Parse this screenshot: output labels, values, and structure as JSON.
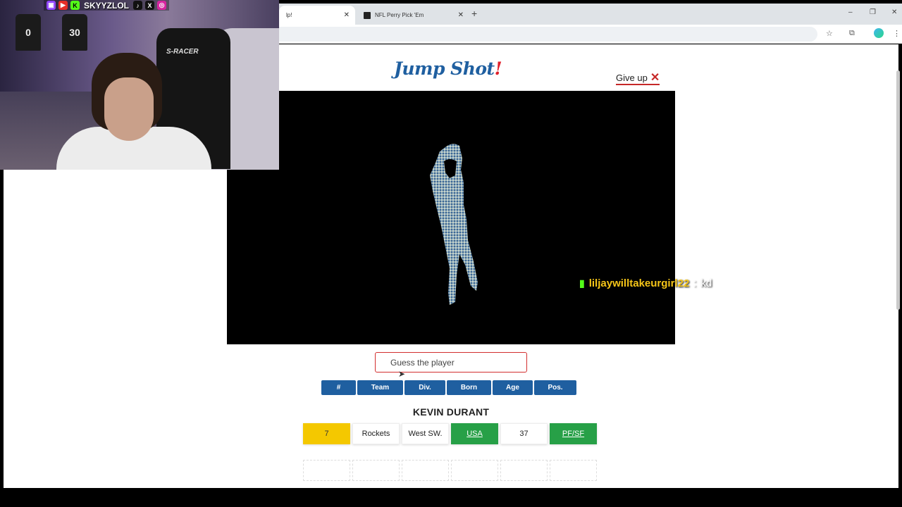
{
  "browser": {
    "tabs": [
      {
        "label": "lp!",
        "active": true
      },
      {
        "label": "NFL Perry Pick 'Em",
        "active": false
      }
    ],
    "new_tab": "+",
    "window_controls": {
      "minimize": "–",
      "restore": "❐",
      "close": "✕"
    }
  },
  "game": {
    "title": "Jump Shot",
    "title_bang": "!",
    "give_up": "Give up",
    "guess_placeholder": "Guess the player",
    "columns": [
      "#",
      "Team",
      "Div.",
      "Born",
      "Age",
      "Pos."
    ],
    "guesses": [
      {
        "name": "KEVIN DURANT",
        "cells": [
          {
            "value": "7",
            "status": "yellow"
          },
          {
            "value": "Rockets",
            "status": "none"
          },
          {
            "value": "West SW.",
            "status": "none"
          },
          {
            "value": "USA",
            "status": "green"
          },
          {
            "value": "37",
            "status": "none"
          },
          {
            "value": "PF/SF",
            "status": "green"
          }
        ]
      }
    ],
    "colors": {
      "primary": "#1f5fa0",
      "yellow": "#f4c800",
      "green": "#27a047",
      "red": "#d32f2f"
    }
  },
  "chat": {
    "username": "liljaywilltakeurgirl22",
    "separator": ":",
    "message": "kd"
  },
  "stream": {
    "handle": "SKYYZLOL",
    "jersey_numbers": [
      "0",
      "30"
    ],
    "chair_brand": "S-RACER"
  }
}
